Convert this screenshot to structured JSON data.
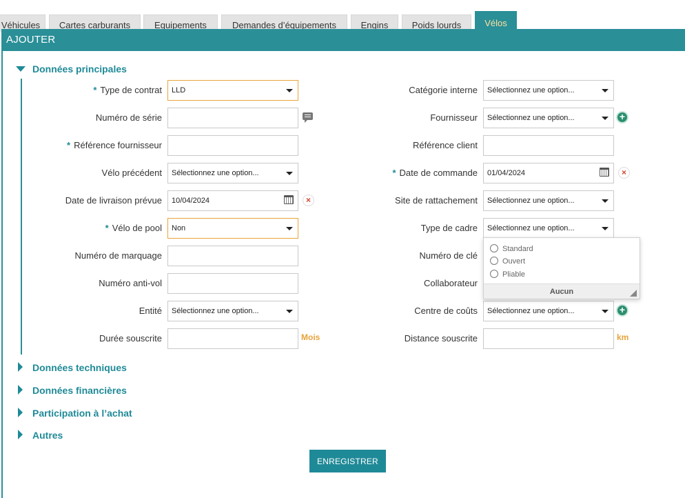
{
  "tabs": [
    "Véhicules",
    "Cartes carburants",
    "Equipements",
    "Demandes d’équipements",
    "Engins",
    "Poids lourds",
    "Vélos"
  ],
  "active_tab": "Vélos",
  "modal": {
    "title": "AJOUTER"
  },
  "sections": {
    "main": "Données principales",
    "technical": "Données techniques",
    "financial": "Données financières",
    "purchase": "Participation à l’achat",
    "other": "Autres"
  },
  "required_marker": "*",
  "left": {
    "type_contrat": {
      "label": "Type de contrat",
      "value": "LLD"
    },
    "numero_serie": {
      "label": "Numéro de série",
      "value": ""
    },
    "ref_fournisseur": {
      "label": "Référence fournisseur",
      "value": ""
    },
    "velo_precedent": {
      "label": "Vélo précédent",
      "value": "Sélectionnez une option..."
    },
    "date_livraison": {
      "label": "Date de livraison prévue",
      "value": "10/04/2024"
    },
    "velo_pool": {
      "label": "Vélo de pool",
      "value": "Non"
    },
    "numero_marquage": {
      "label": "Numéro de marquage",
      "value": ""
    },
    "numero_antivol": {
      "label": "Numéro anti-vol",
      "value": ""
    },
    "entite": {
      "label": "Entité",
      "value": "Sélectionnez une option..."
    },
    "duree": {
      "label": "Durée souscrite",
      "value": "",
      "unit": "Mois"
    }
  },
  "right": {
    "categorie": {
      "label": "Catégorie interne",
      "value": "Sélectionnez une option..."
    },
    "fournisseur": {
      "label": "Fournisseur",
      "value": "Sélectionnez une option..."
    },
    "ref_client": {
      "label": "Référence client",
      "value": ""
    },
    "date_commande": {
      "label": "Date de commande",
      "value": "01/04/2024"
    },
    "site": {
      "label": "Site de rattachement",
      "value": "Sélectionnez une option..."
    },
    "type_cadre": {
      "label": "Type de cadre",
      "value": "Sélectionnez une option..."
    },
    "numero_cle": {
      "label": "Numéro de clé",
      "value": ""
    },
    "collaborateur": {
      "label": "Collaborateur",
      "value": ""
    },
    "centre_couts": {
      "label": "Centre de coûts",
      "value": "Sélectionnez une option..."
    },
    "distance": {
      "label": "Distance souscrite",
      "value": "",
      "unit": "km"
    }
  },
  "type_cadre_dropdown": {
    "options": [
      "Standard",
      "Ouvert",
      "Pliable"
    ],
    "none_label": "Aucun"
  },
  "save_label": "ENREGISTRER",
  "colors": {
    "accent": "#2a8f97",
    "focus": "#e8a33a",
    "clear": "#d9442b",
    "add": "#2a8f6f"
  },
  "icons": {
    "calendar": "calendar-icon",
    "clear": "clear-icon",
    "add": "add-icon",
    "comment": "comment-icon"
  }
}
